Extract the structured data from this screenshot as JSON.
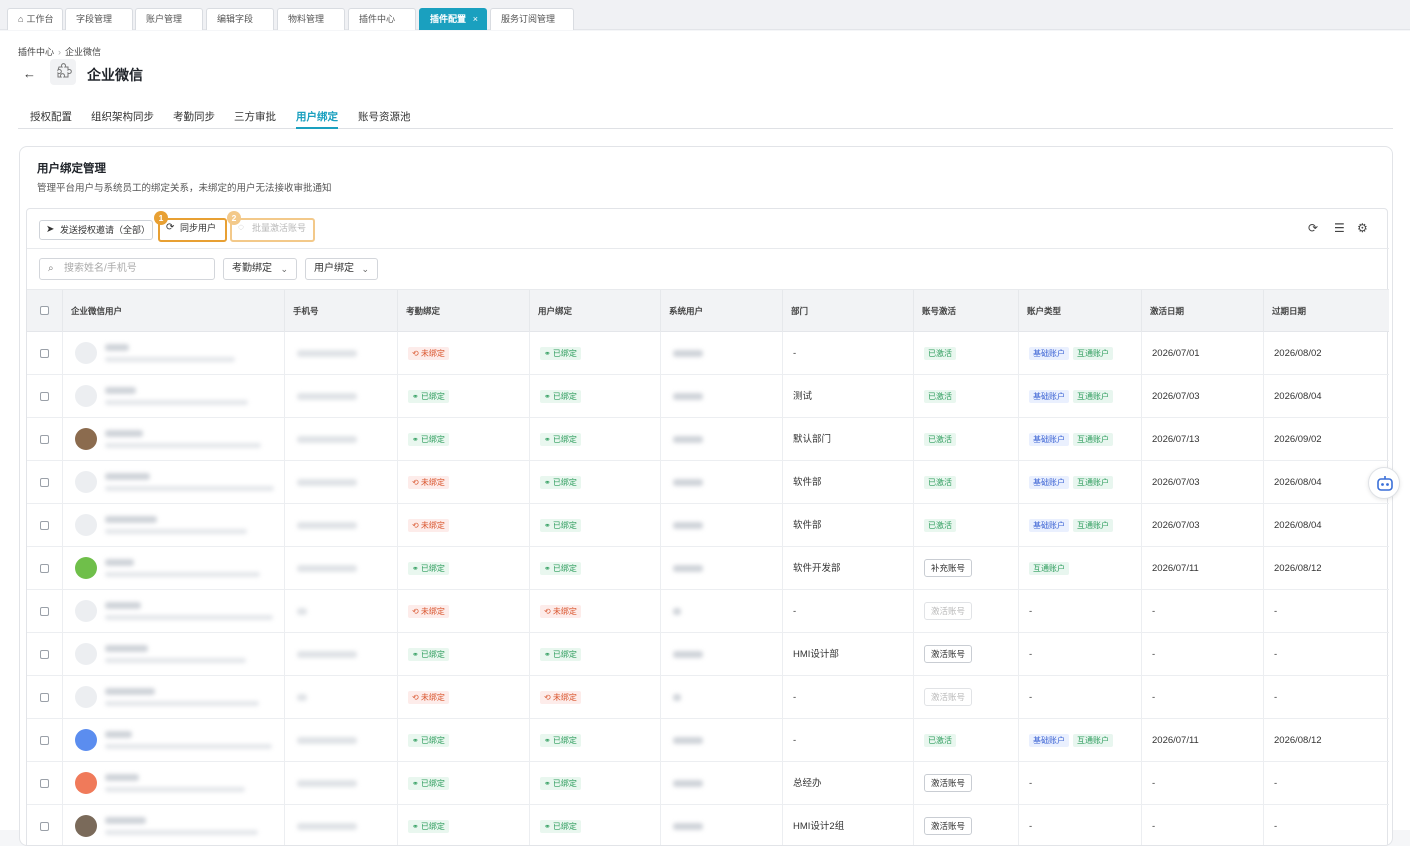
{
  "window_tabs": [
    {
      "label": "工作台",
      "active": false,
      "has_home": true
    },
    {
      "label": "字段管理",
      "active": false
    },
    {
      "label": "账户管理",
      "active": false
    },
    {
      "label": "编辑字段",
      "active": false
    },
    {
      "label": "物料管理",
      "active": false
    },
    {
      "label": "插件中心",
      "active": false
    },
    {
      "label": "插件配置",
      "active": true,
      "close": "×"
    },
    {
      "label": "服务订阅管理",
      "active": false
    }
  ],
  "breadcrumb": {
    "parent": "插件中心",
    "sep": "›",
    "current": "企业微信"
  },
  "header": {
    "back": "←",
    "title": "企业微信"
  },
  "sub_tabs": [
    {
      "label": "授权配置",
      "active": false
    },
    {
      "label": "组织架构同步",
      "active": false
    },
    {
      "label": "考勤同步",
      "active": false
    },
    {
      "label": "三方审批",
      "active": false
    },
    {
      "label": "用户绑定",
      "active": true
    },
    {
      "label": "账号资源池",
      "active": false
    }
  ],
  "card": {
    "title": "用户绑定管理",
    "description": "管理平台用户与系统员工的绑定关系，未绑定的用户无法接收审批通知"
  },
  "toolbar": {
    "send_invite": "发送授权邀请（全部）",
    "sync_users": "同步用户",
    "batch_activate": "批量激活账号",
    "badge1": "1",
    "badge2": "2"
  },
  "filters": {
    "search_placeholder": "搜索姓名/手机号",
    "attendance_dd": "考勤绑定",
    "user_dd": "用户绑定"
  },
  "columns": [
    "企业微信用户",
    "手机号",
    "考勤绑定",
    "用户绑定",
    "系统用户",
    "部门",
    "账号激活",
    "账户类型",
    "激活日期",
    "过期日期"
  ],
  "rows": [
    {
      "avatar": "#eceef1",
      "att": "未绑定",
      "att_bound": false,
      "usr": "已绑定",
      "usr_bound": true,
      "dept": "-",
      "act_type": "tag",
      "act": "已激活",
      "types": [
        "基础账户",
        "互通账户"
      ],
      "start": "2026/07/01",
      "end": "2026/08/02"
    },
    {
      "avatar": "#eceef1",
      "att": "已绑定",
      "att_bound": true,
      "usr": "已绑定",
      "usr_bound": true,
      "dept": "测试",
      "act_type": "tag",
      "act": "已激活",
      "types": [
        "基础账户",
        "互通账户"
      ],
      "start": "2026/07/03",
      "end": "2026/08/04"
    },
    {
      "avatar": "#8b6b4e",
      "att": "已绑定",
      "att_bound": true,
      "usr": "已绑定",
      "usr_bound": true,
      "dept": "默认部门",
      "act_type": "tag",
      "act": "已激活",
      "types": [
        "基础账户",
        "互通账户"
      ],
      "start": "2026/07/13",
      "end": "2026/09/02"
    },
    {
      "avatar": "#eceef1",
      "att": "未绑定",
      "att_bound": false,
      "usr": "已绑定",
      "usr_bound": true,
      "dept": "软件部",
      "act_type": "tag",
      "act": "已激活",
      "types": [
        "基础账户",
        "互通账户"
      ],
      "start": "2026/07/03",
      "end": "2026/08/04"
    },
    {
      "avatar": "#eceef1",
      "att": "未绑定",
      "att_bound": false,
      "usr": "已绑定",
      "usr_bound": true,
      "dept": "软件部",
      "act_type": "tag",
      "act": "已激活",
      "types": [
        "基础账户",
        "互通账户"
      ],
      "start": "2026/07/03",
      "end": "2026/08/04"
    },
    {
      "avatar": "#6fbf4a",
      "att": "已绑定",
      "att_bound": true,
      "usr": "已绑定",
      "usr_bound": true,
      "dept": "软件开发部",
      "act_type": "button",
      "act": "补充账号",
      "types": [
        "互通账户"
      ],
      "start": "2026/07/11",
      "end": "2026/08/12"
    },
    {
      "avatar": "#eceef1",
      "att": "未绑定",
      "att_bound": false,
      "usr": "未绑定",
      "usr_bound": false,
      "dept": "-",
      "act_type": "button_disabled",
      "act": "激活账号",
      "types": [],
      "types_text": "-",
      "start": "-",
      "end": "-"
    },
    {
      "avatar": "#eceef1",
      "att": "已绑定",
      "att_bound": true,
      "usr": "已绑定",
      "usr_bound": true,
      "dept": "HMI设计部",
      "act_type": "button",
      "act": "激活账号",
      "types": [],
      "types_text": "-",
      "start": "-",
      "end": "-"
    },
    {
      "avatar": "#eceef1",
      "att": "未绑定",
      "att_bound": false,
      "usr": "未绑定",
      "usr_bound": false,
      "dept": "-",
      "act_type": "button_disabled",
      "act": "激活账号",
      "types": [],
      "types_text": "-",
      "start": "-",
      "end": "-"
    },
    {
      "avatar": "#5b8def",
      "att": "已绑定",
      "att_bound": true,
      "usr": "已绑定",
      "usr_bound": true,
      "dept": "-",
      "act_type": "tag",
      "act": "已激活",
      "types": [
        "基础账户",
        "互通账户"
      ],
      "start": "2026/07/11",
      "end": "2026/08/12"
    },
    {
      "avatar": "#f07a5a",
      "att": "已绑定",
      "att_bound": true,
      "usr": "已绑定",
      "usr_bound": true,
      "dept": "总经办",
      "act_type": "button",
      "act": "激活账号",
      "types": [],
      "types_text": "-",
      "start": "-",
      "end": "-"
    },
    {
      "avatar": "#7a6a5a",
      "att": "已绑定",
      "att_bound": true,
      "usr": "已绑定",
      "usr_bound": true,
      "dept": "HMI设计2组",
      "act_type": "button",
      "act": "激活账号",
      "types": [],
      "types_text": "-",
      "start": "-",
      "end": "-"
    }
  ],
  "colors": {
    "accent": "#1aa0bf",
    "badge1": "#e8a033",
    "badge2": "#f3c98a"
  }
}
